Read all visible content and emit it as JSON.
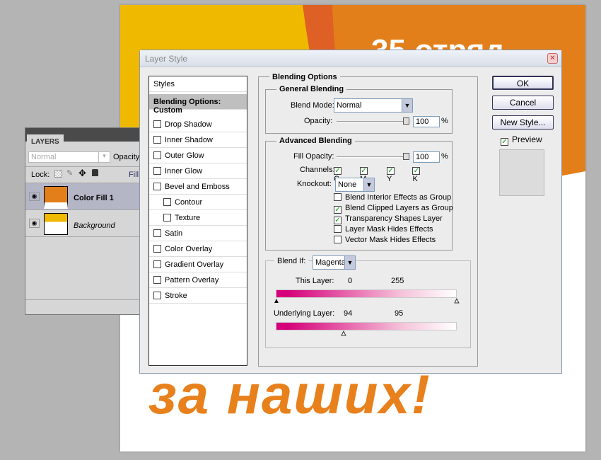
{
  "canvas": {
    "top_text": "35 отряд",
    "bottom_text": "за наших!"
  },
  "layers": {
    "tab": "LAYERS",
    "blend_mode": "Normal",
    "opacity_label": "Opacity:",
    "lock_label": "Lock:",
    "fill_label": "Fill:",
    "items": [
      {
        "name": "Color Fill 1",
        "selected": true
      },
      {
        "name": "Background",
        "selected": false
      }
    ]
  },
  "dialog": {
    "title": "Layer Style",
    "styles_header": "Styles",
    "styles": [
      {
        "label": "Blending Options: Custom",
        "selected": true
      },
      {
        "label": "Drop Shadow"
      },
      {
        "label": "Inner Shadow"
      },
      {
        "label": "Outer Glow"
      },
      {
        "label": "Inner Glow"
      },
      {
        "label": "Bevel and Emboss"
      },
      {
        "label": "Contour",
        "indent": true
      },
      {
        "label": "Texture",
        "indent": true
      },
      {
        "label": "Satin"
      },
      {
        "label": "Color Overlay"
      },
      {
        "label": "Gradient Overlay"
      },
      {
        "label": "Pattern Overlay"
      },
      {
        "label": "Stroke"
      }
    ],
    "blending_options": "Blending Options",
    "general": {
      "title": "General Blending",
      "blend_mode_label": "Blend Mode:",
      "blend_mode": "Normal",
      "opacity_label": "Opacity:",
      "opacity": "100",
      "pct": "%"
    },
    "advanced": {
      "title": "Advanced Blending",
      "fill_label": "Fill Opacity:",
      "fill": "100",
      "pct": "%",
      "channels_label": "Channels:",
      "channels": [
        {
          "label": "C",
          "checked": true
        },
        {
          "label": "M",
          "checked": true
        },
        {
          "label": "Y",
          "checked": true
        },
        {
          "label": "K",
          "checked": true
        }
      ],
      "knockout_label": "Knockout:",
      "knockout": "None",
      "options": [
        {
          "label": "Blend Interior Effects as Group",
          "checked": false
        },
        {
          "label": "Blend Clipped Layers as Group",
          "checked": true
        },
        {
          "label": "Transparency Shapes Layer",
          "checked": true
        },
        {
          "label": "Layer Mask Hides Effects",
          "checked": false
        },
        {
          "label": "Vector Mask Hides Effects",
          "checked": false
        }
      ]
    },
    "blend_if": {
      "label": "Blend If:",
      "channel": "Magenta",
      "this_layer_label": "This Layer:",
      "this_low": "0",
      "this_high": "255",
      "under_label": "Underlying Layer:",
      "under_low": "94",
      "under_high": "95"
    },
    "buttons": {
      "ok": "OK",
      "cancel": "Cancel",
      "new_style": "New Style...",
      "preview": "Preview"
    }
  }
}
